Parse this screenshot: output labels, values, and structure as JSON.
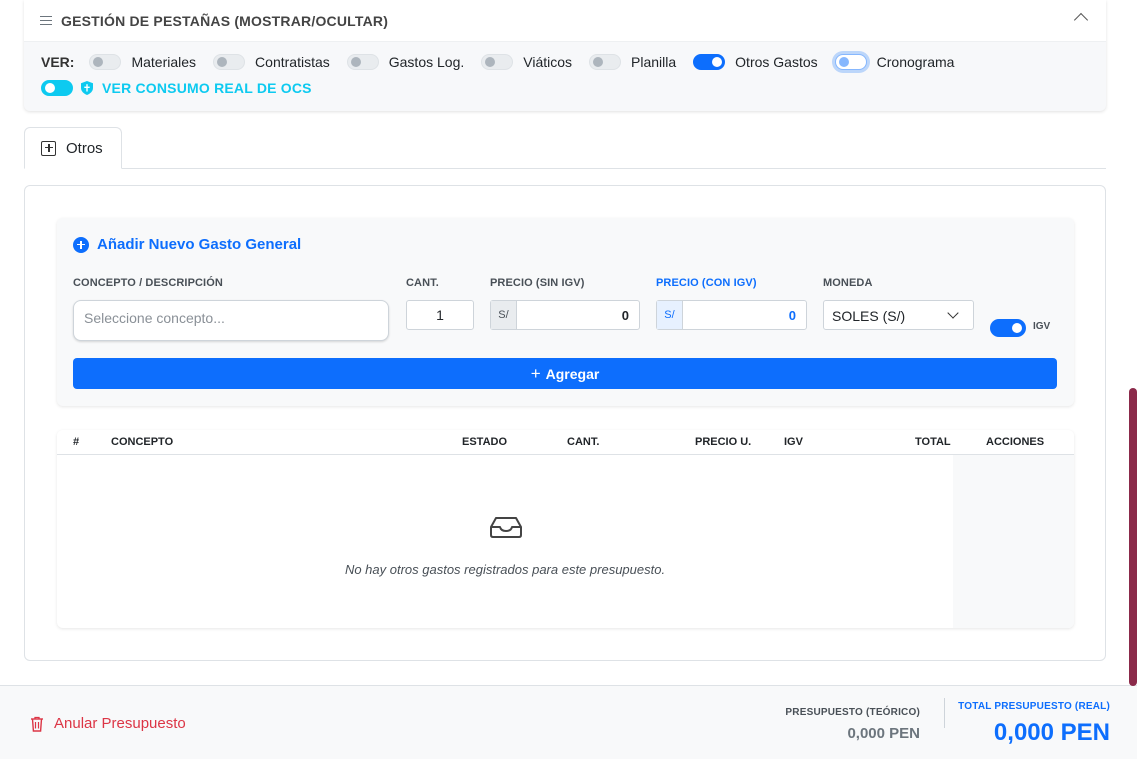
{
  "tabs_manager": {
    "title": "GESTIÓN DE PESTAÑAS (MOSTRAR/OCULTAR)",
    "ver_label": "VER:",
    "toggles": [
      {
        "label": "Materiales",
        "on": false
      },
      {
        "label": "Contratistas",
        "on": false
      },
      {
        "label": "Gastos Log.",
        "on": false
      },
      {
        "label": "Viáticos",
        "on": false
      },
      {
        "label": "Planilla",
        "on": false
      },
      {
        "label": "Otros Gastos",
        "on": true
      },
      {
        "label": "Cronograma",
        "on": false
      }
    ],
    "ocs_label": "VER CONSUMO REAL DE OCS",
    "ocs_on": true
  },
  "tabs": [
    {
      "label": "Otros",
      "active": true
    }
  ],
  "form": {
    "title": "Añadir Nuevo Gasto General",
    "concept_label": "CONCEPTO / DESCRIPCIÓN",
    "concept_placeholder": "Seleccione concepto...",
    "cant_label": "CANT.",
    "cant_value": "1",
    "precio_sin_label": "PRECIO (SIN IGV)",
    "precio_sin_prefix": "S/",
    "precio_sin_value": "0",
    "precio_con_label": "PRECIO (CON IGV)",
    "precio_con_prefix": "S/",
    "precio_con_value": "0",
    "moneda_label": "MONEDA",
    "moneda_value": "SOLES (S/)",
    "igv_label": "IGV",
    "igv_on": true,
    "add_button": "Agregar"
  },
  "table": {
    "columns": [
      "#",
      "CONCEPTO",
      "ESTADO",
      "CANT.",
      "PRECIO U.",
      "IGV",
      "TOTAL",
      "ACCIONES"
    ],
    "rows": [],
    "empty_message": "No hay otros gastos registrados para este presupuesto."
  },
  "footer": {
    "anular_label": "Anular Presupuesto",
    "teorico_label": "PRESUPUESTO (TEÓRICO)",
    "teorico_value": "0,000 PEN",
    "real_label": "TOTAL PRESUPUESTO (REAL)",
    "real_value": "0,000 PEN"
  },
  "colors": {
    "primary": "#0d6efd",
    "info": "#0dcaf0",
    "danger": "#dc3545",
    "scrollbar": "#8b2a4a"
  }
}
